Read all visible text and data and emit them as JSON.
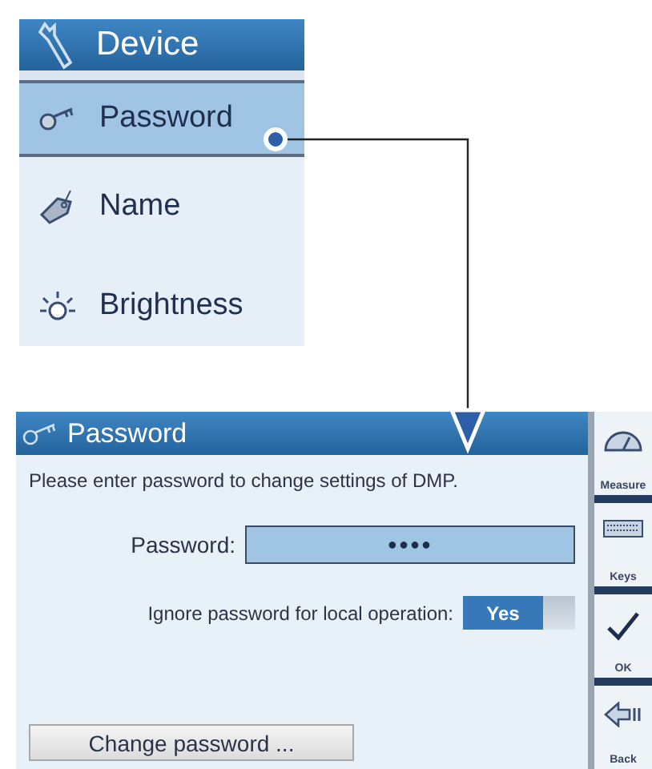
{
  "menu": {
    "title": "Device",
    "items": [
      {
        "label": "Password",
        "kind": "key",
        "selected": true
      },
      {
        "label": "Name",
        "kind": "tag",
        "selected": false
      },
      {
        "label": "Brightness",
        "kind": "sun",
        "selected": false
      }
    ]
  },
  "dialog": {
    "title": "Password",
    "instruction": "Please enter password to change settings of DMP.",
    "password": {
      "label": "Password:",
      "value": "●●●●"
    },
    "ignore_local": {
      "label": "Ignore password for local operation:",
      "on": true,
      "on_text": "Yes"
    },
    "change_button": "Change password ..."
  },
  "side_buttons": [
    {
      "label": "Measure",
      "kind": "gauge"
    },
    {
      "label": "Keys",
      "kind": "keyboard"
    },
    {
      "label": "OK",
      "kind": "check"
    },
    {
      "label": "Back",
      "kind": "back"
    }
  ]
}
